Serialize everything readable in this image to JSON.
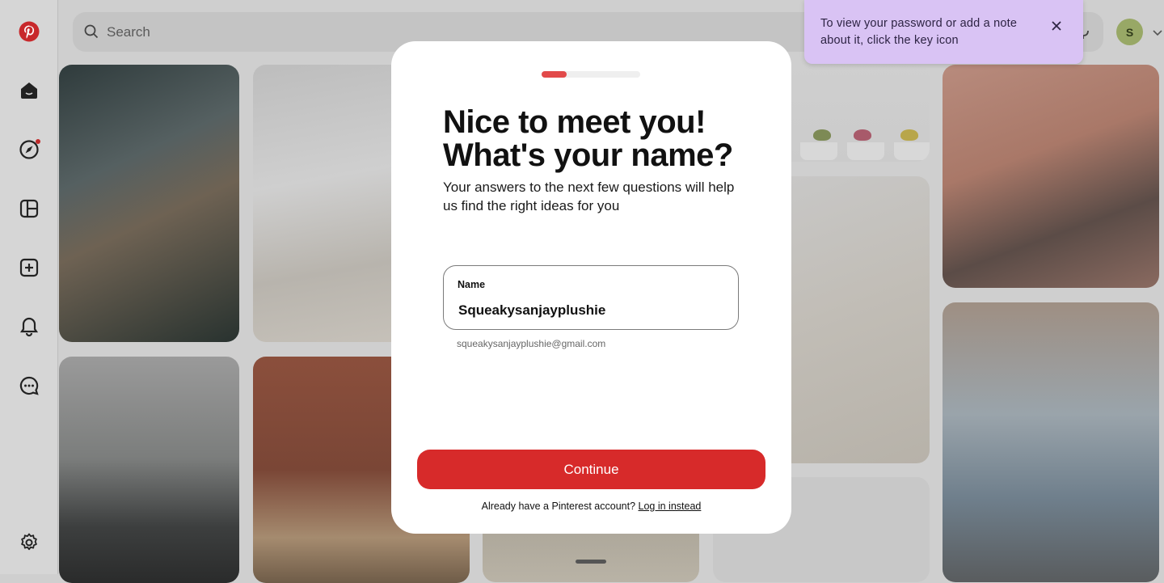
{
  "search": {
    "placeholder": "Search"
  },
  "sidebar": {
    "items": [
      {
        "name": "pinterest-logo-icon"
      },
      {
        "name": "home-icon"
      },
      {
        "name": "explore-icon"
      },
      {
        "name": "boards-icon"
      },
      {
        "name": "create-icon"
      },
      {
        "name": "notifications-icon"
      },
      {
        "name": "messages-icon"
      },
      {
        "name": "settings-icon"
      }
    ]
  },
  "header": {
    "avatar_initial": "S"
  },
  "toast": {
    "message": "To view your password or add a note about it, click the key icon"
  },
  "modal": {
    "progress": 0.25,
    "title": "Nice to meet you! What's your name?",
    "subtitle": "Your answers to the next few questions will help us find the right ideas for you",
    "name_label": "Name",
    "name_value": "Squeakysanjayplushie",
    "email": "squeakysanjayplushie@gmail.com",
    "continue_label": "Continue",
    "login_prompt": "Already have a Pinterest account?",
    "login_link": "Log in instead"
  },
  "colors": {
    "brand_red": "#d72a2a",
    "progress_red": "#e24a4a",
    "toast_bg": "#d9c3f4",
    "avatar_bg": "#98a866"
  }
}
